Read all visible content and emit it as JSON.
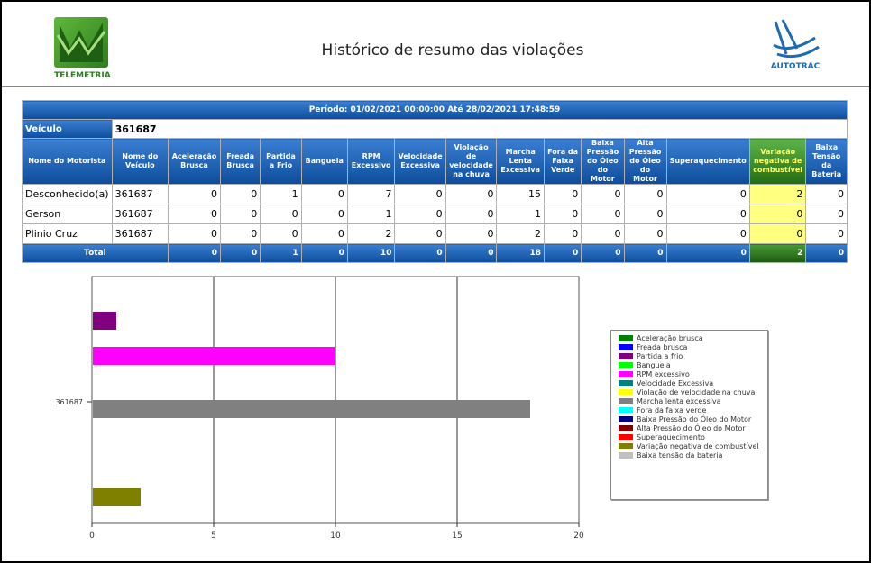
{
  "header": {
    "title": "Histórico de resumo das violações",
    "left_logo_label": "TELEMETRIA",
    "right_logo_label": "AUTOTRAC"
  },
  "period": "Período: 01/02/2021 00:00:00 Até 28/02/2021 17:48:59",
  "vehicle_label": "Veículo",
  "vehicle_value": "361687",
  "columns": [
    "Nome do Motorista",
    "Nome do Veículo",
    "Aceleração Brusca",
    "Freada Brusca",
    "Partida a Frio",
    "Banguela",
    "RPM Excessivo",
    "Velocidade Excessiva",
    "Violação de velocidade na chuva",
    "Marcha Lenta Excessiva",
    "Fora da Faixa Verde",
    "Baixa Pressão do Óleo do Motor",
    "Alta Pressão do Óleo do Motor",
    "Superaquecimento",
    "Variação negativa de combustível",
    "Baixa Tensão da Bateria"
  ],
  "rows": [
    {
      "driver": "Desconhecido(a)",
      "vehicle": "361687",
      "values": [
        "0",
        "0",
        "1",
        "0",
        "7",
        "0",
        "0",
        "15",
        "0",
        "0",
        "0",
        "0",
        "2",
        "0"
      ]
    },
    {
      "driver": "Gerson",
      "vehicle": "361687",
      "values": [
        "0",
        "0",
        "0",
        "0",
        "1",
        "0",
        "0",
        "1",
        "0",
        "0",
        "0",
        "0",
        "0",
        "0"
      ]
    },
    {
      "driver": "Plinio Cruz",
      "vehicle": "361687",
      "values": [
        "0",
        "0",
        "0",
        "0",
        "2",
        "0",
        "0",
        "2",
        "0",
        "0",
        "0",
        "0",
        "0",
        "0"
      ]
    }
  ],
  "total": {
    "label": "Total",
    "values": [
      "0",
      "0",
      "1",
      "0",
      "10",
      "0",
      "0",
      "18",
      "0",
      "0",
      "0",
      "0",
      "2",
      "0"
    ]
  },
  "chart_data": {
    "type": "bar",
    "orientation": "horizontal",
    "categories": [
      "361687"
    ],
    "xlim": [
      0,
      20
    ],
    "xticks": [
      "0",
      "5",
      "10",
      "15",
      "20"
    ],
    "grid": true,
    "legend_position": "right",
    "series": [
      {
        "name": "Aceleração brusca",
        "values": [
          0
        ],
        "color": "#008000"
      },
      {
        "name": "Freada brusca",
        "values": [
          0
        ],
        "color": "#0000ff"
      },
      {
        "name": "Partida a frio",
        "values": [
          1
        ],
        "color": "#800080"
      },
      {
        "name": "Banguela",
        "values": [
          0
        ],
        "color": "#00ff00"
      },
      {
        "name": "RPM excessivo",
        "values": [
          10
        ],
        "color": "#ff00ff"
      },
      {
        "name": "Velocidade Excessiva",
        "values": [
          0
        ],
        "color": "#008080"
      },
      {
        "name": "Violação de velocidade na chuva",
        "values": [
          0
        ],
        "color": "#ffff00"
      },
      {
        "name": "Marcha lenta excessiva",
        "values": [
          18
        ],
        "color": "#808080"
      },
      {
        "name": "Fora da faixa verde",
        "values": [
          0
        ],
        "color": "#00ffff"
      },
      {
        "name": "Baixa Pressão do Óleo do Motor",
        "values": [
          0
        ],
        "color": "#000080"
      },
      {
        "name": "Alta Pressão do Óleo do Motor",
        "values": [
          0
        ],
        "color": "#800000"
      },
      {
        "name": "Superaquecimento",
        "values": [
          0
        ],
        "color": "#ff0000"
      },
      {
        "name": "Variação negativa de combustível",
        "values": [
          2
        ],
        "color": "#808000"
      },
      {
        "name": "Baixa tensão da bateria",
        "values": [
          0
        ],
        "color": "#c0c0c0"
      }
    ]
  }
}
